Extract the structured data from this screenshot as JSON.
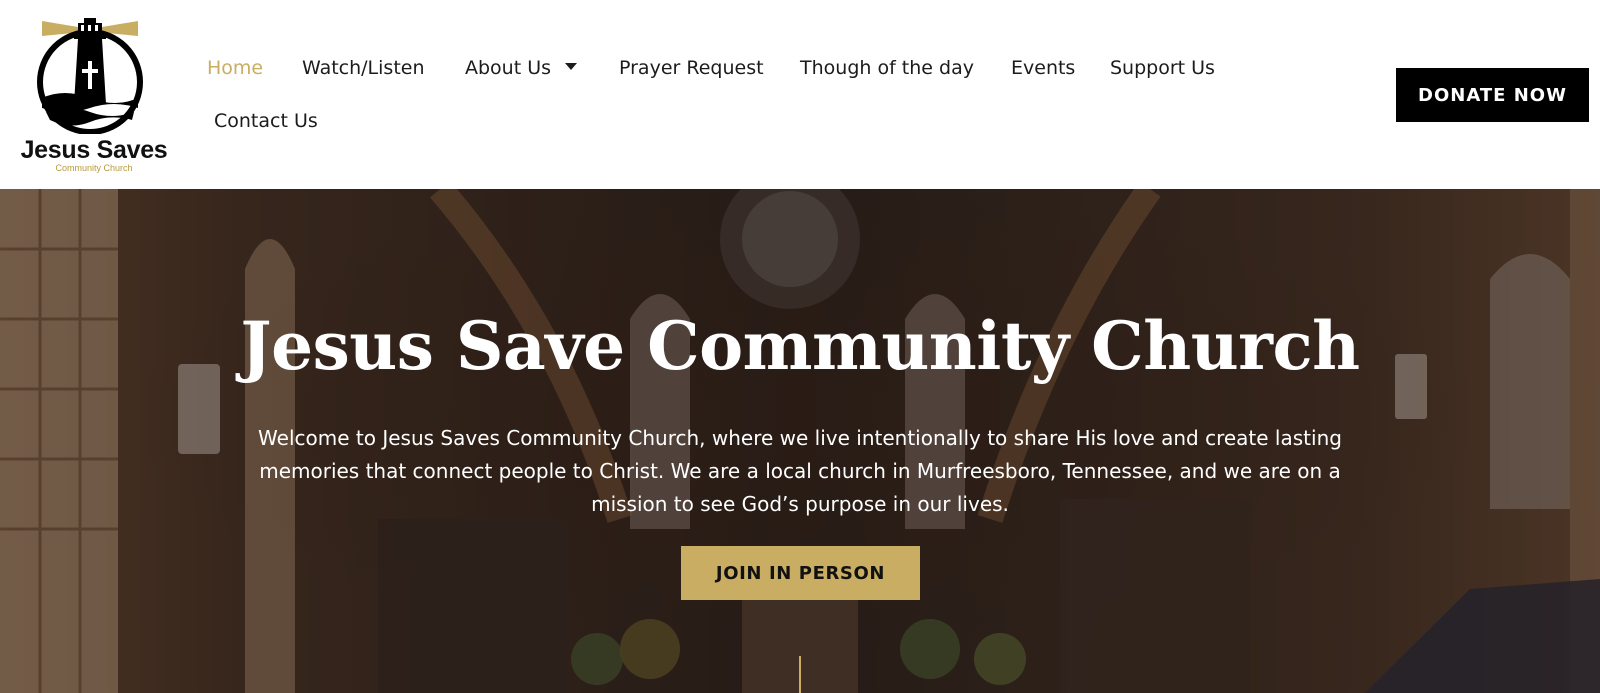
{
  "logo": {
    "name": "Jesus Saves",
    "subtitle": "Community Church"
  },
  "nav": {
    "items": [
      {
        "label": "Home",
        "active": true
      },
      {
        "label": "Watch/Listen"
      },
      {
        "label": "About Us",
        "has_dropdown": true
      },
      {
        "label": "Prayer Request"
      },
      {
        "label": "Though of the day"
      },
      {
        "label": "Events"
      },
      {
        "label": "Support Us"
      },
      {
        "label": "Contact Us"
      }
    ],
    "donate_label": "DONATE NOW"
  },
  "hero": {
    "title": "Jesus Save Community Church",
    "text": "Welcome to Jesus Saves Community Church, where we live intentionally to share His love and create lasting memories that connect people to Christ. We are a local church in Murfreesboro, Tennessee, and we are on a mission to see God’s purpose in our lives.",
    "button_label": "JOIN IN PERSON"
  },
  "colors": {
    "accent": "#c9ad62",
    "text_dark": "#1c1c1c",
    "donate_bg": "#000000"
  }
}
